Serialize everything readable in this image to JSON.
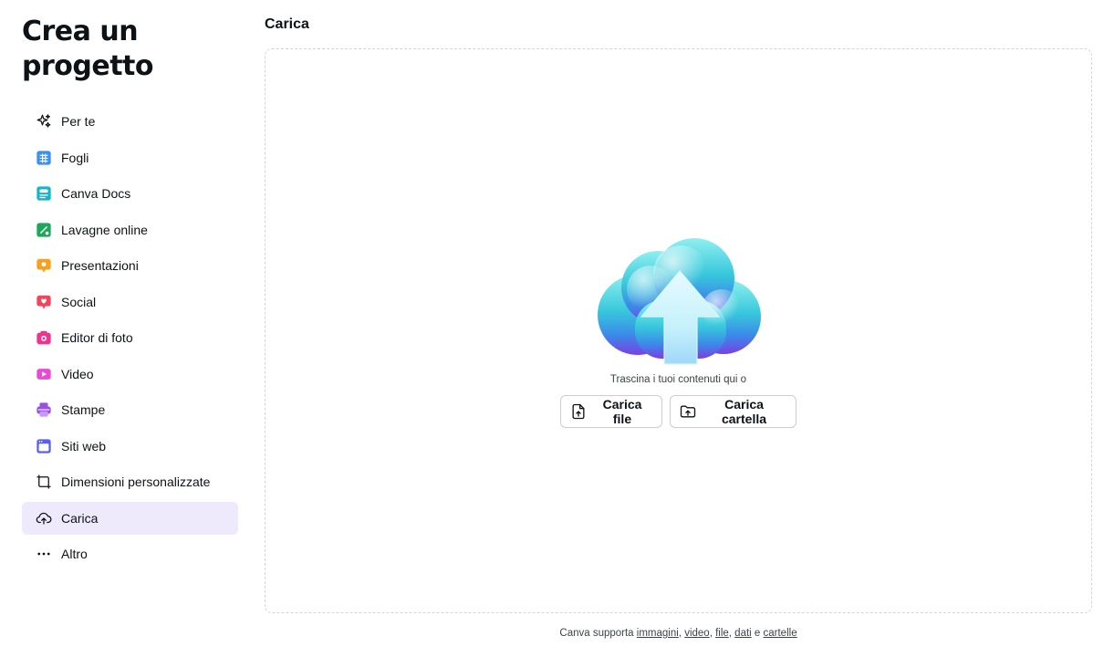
{
  "sidebar": {
    "title": "Crea un progetto",
    "items": [
      {
        "label": "Per te",
        "icon": "sparkle-icon"
      },
      {
        "label": "Fogli",
        "icon": "sheets-icon",
        "color": "#3b8ff5"
      },
      {
        "label": "Canva Docs",
        "icon": "docs-icon",
        "color": "#13b5c9"
      },
      {
        "label": "Lavagne online",
        "icon": "whiteboard-icon",
        "color": "#1aa85a"
      },
      {
        "label": "Presentazioni",
        "icon": "presentation-icon",
        "color": "#f5a020"
      },
      {
        "label": "Social",
        "icon": "heart-icon",
        "color": "#f2455b"
      },
      {
        "label": "Editor di foto",
        "icon": "camera-icon",
        "color": "#f0338f"
      },
      {
        "label": "Video",
        "icon": "video-icon",
        "color": "#e84ad8"
      },
      {
        "label": "Stampe",
        "icon": "print-icon",
        "color": "#9b4de8"
      },
      {
        "label": "Siti web",
        "icon": "website-icon",
        "color": "#5a5ff0"
      },
      {
        "label": "Dimensioni personalizzate",
        "icon": "resize-icon"
      },
      {
        "label": "Carica",
        "icon": "cloud-upload-icon",
        "active": true
      },
      {
        "label": "Altro",
        "icon": "more-icon"
      }
    ]
  },
  "main": {
    "title": "Carica",
    "drop_text": "Trascina i tuoi contenuti qui o",
    "upload_file_label": "Carica file",
    "upload_folder_label": "Carica cartella"
  },
  "footer": {
    "prefix": "Canva supporta ",
    "links": [
      "immagini",
      "video",
      "file",
      "dati",
      "cartelle"
    ],
    "sep": ", ",
    "and": " e "
  },
  "colors": {
    "accent_active_bg": "#efe9fc"
  }
}
